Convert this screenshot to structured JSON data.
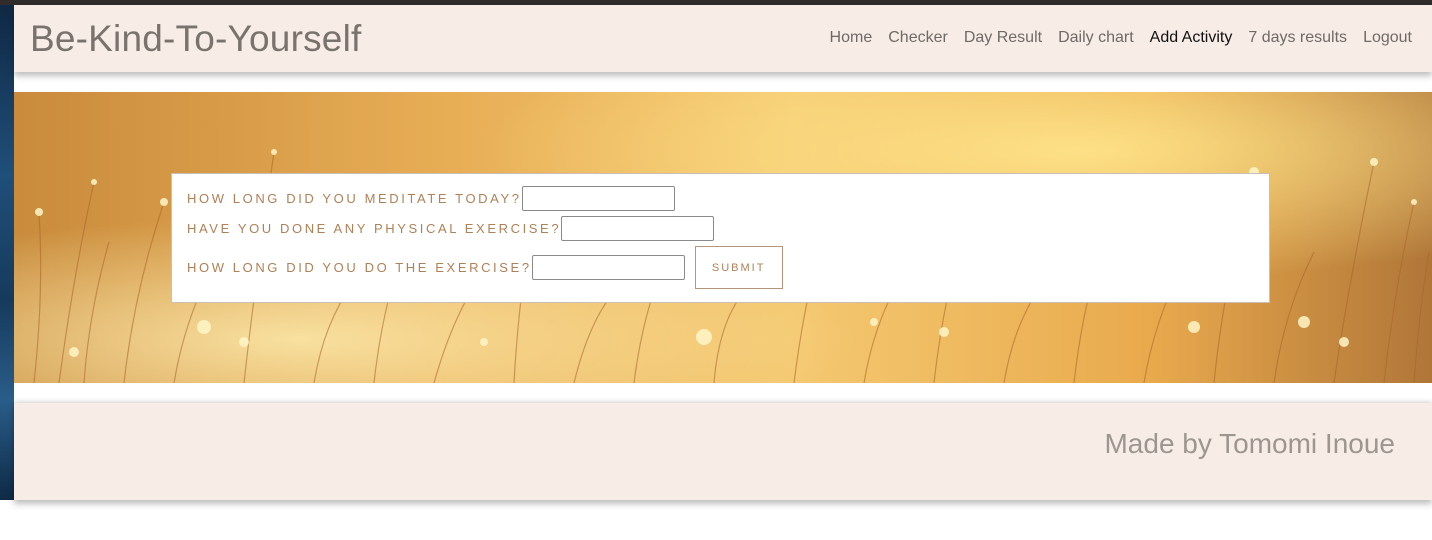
{
  "header": {
    "brand": "Be-Kind-To-Yourself",
    "nav": [
      "Home",
      "Checker",
      "Day Result",
      "Daily chart",
      "Add Activity",
      "7 days results",
      "Logout"
    ],
    "active_nav": "Add Activity"
  },
  "form": {
    "meditate_label": "How long did you meditate today?",
    "meditate_value": "",
    "exercise_label": "Have you done any physical exercise?",
    "exercise_value": "",
    "duration_label": "How long did you do the exercise?",
    "duration_value": "",
    "submit_label": "Submit"
  },
  "footer": {
    "credit": "Made by Tomomi Inoue"
  },
  "colors": {
    "header_bg": "#f7ede6",
    "label_color": "#b08057",
    "hero_gold": "#f4c870"
  }
}
